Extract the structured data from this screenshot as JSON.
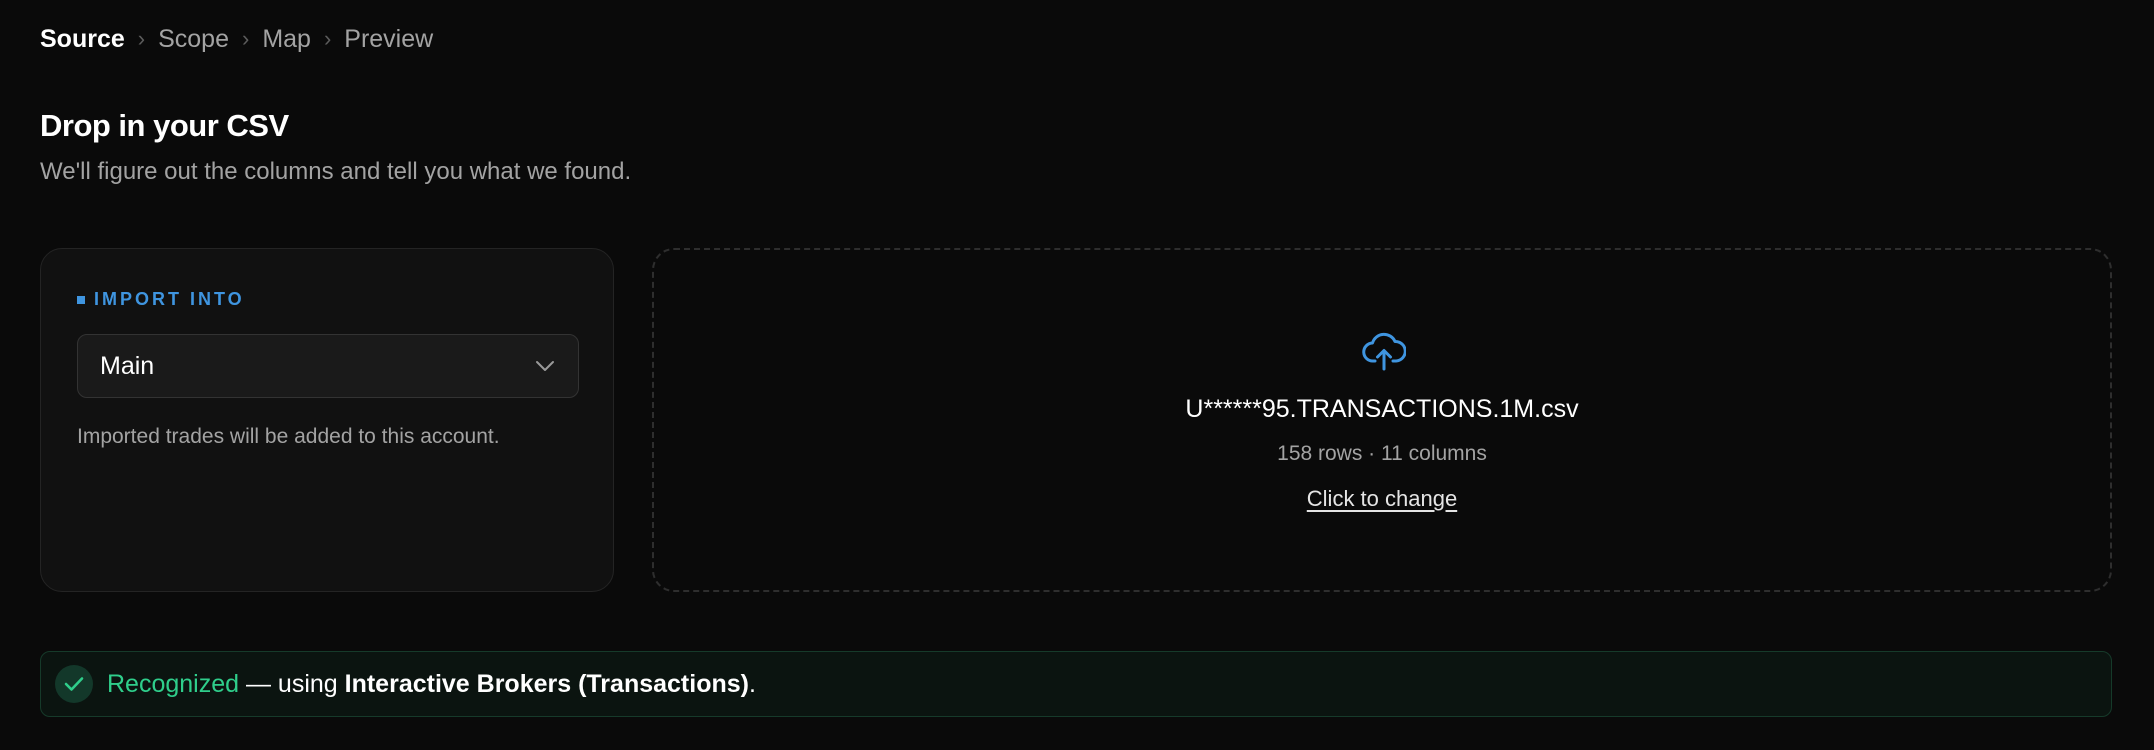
{
  "breadcrumb": {
    "steps": [
      "Source",
      "Scope",
      "Map",
      "Preview"
    ],
    "separator": "›",
    "active_index": 0
  },
  "header": {
    "title": "Drop in your CSV",
    "subtitle": "We'll figure out the columns and tell you what we found."
  },
  "import_into": {
    "label": "IMPORT INTO",
    "selected_account": "Main",
    "help_text": "Imported trades will be added to this account."
  },
  "dropzone": {
    "icon": "cloud-upload-icon",
    "file_name": "U******95.TRANSACTIONS.1M.csv",
    "file_meta": "158 rows · 11 columns",
    "change_label": "Click to change"
  },
  "status": {
    "icon": "check-icon",
    "recognized_label": "Recognized",
    "using_text": " — using ",
    "broker_name": "Interactive Brokers (Transactions)",
    "suffix": "."
  },
  "colors": {
    "background": "#0a0a0a",
    "accent_blue": "#3f95e0",
    "success_green": "#2fce8b",
    "muted_text": "#a3a3a3"
  }
}
